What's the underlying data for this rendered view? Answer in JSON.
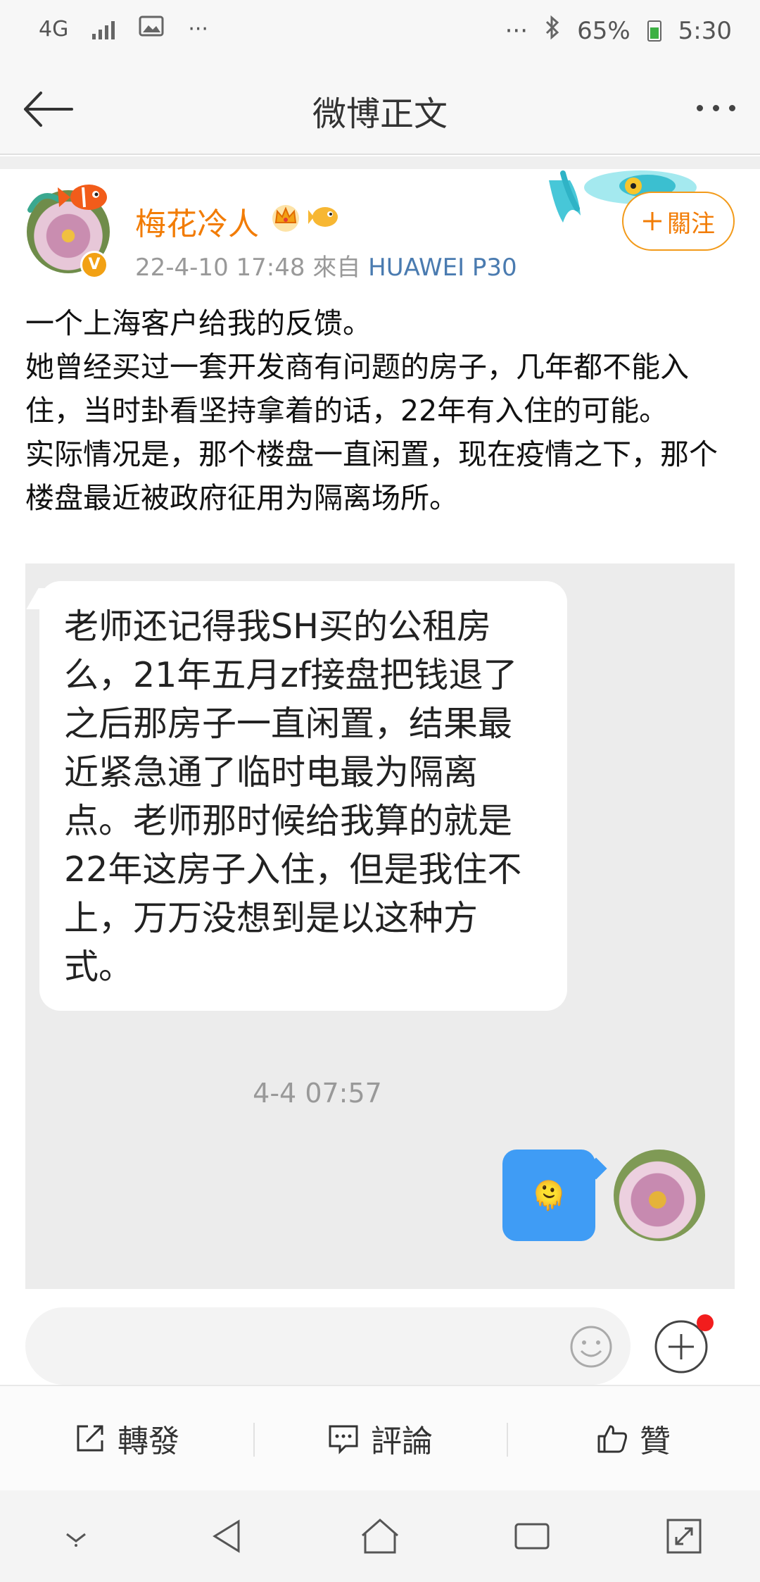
{
  "status_bar": {
    "network": "4G",
    "left_dots": "···",
    "right_dots": "···",
    "battery": "65%",
    "time": "5:30"
  },
  "header": {
    "title": "微博正文"
  },
  "post": {
    "author": "梅花冷人",
    "timestamp": "22-4-10 17:48",
    "source_prefix": "來自",
    "device": "HUAWEI P30",
    "follow_label": "關注",
    "verify_mark": "V",
    "paragraphs": [
      "一个上海客户给我的反馈。",
      "她曾经买过一套开发商有问题的房子，几年都不能入住，当时卦看坚持拿着的话，22年有入住的可能。",
      "实际情况是，那个楼盘一直闲置，现在疫情之下，那个楼盘最近被政府征用为隔离场所。"
    ]
  },
  "screenshot": {
    "message": "老师还记得我SH买的公租房么，21年五月zf接盘把钱退了之后那房子一直闲置，结果最近紧急通了临时电最为隔离点。老师那时候给我算的就是22年这房子入住，但是我住不上，万万没想到是以这种方式。",
    "time": "4-4 07:57",
    "reply_emoji": "🫠"
  },
  "actions": {
    "repost": "轉發",
    "comment": "評論",
    "like": "贊"
  },
  "colors": {
    "accent": "#f27c05",
    "link": "#4a7bb0",
    "chat_blue": "#3f9cf5"
  }
}
